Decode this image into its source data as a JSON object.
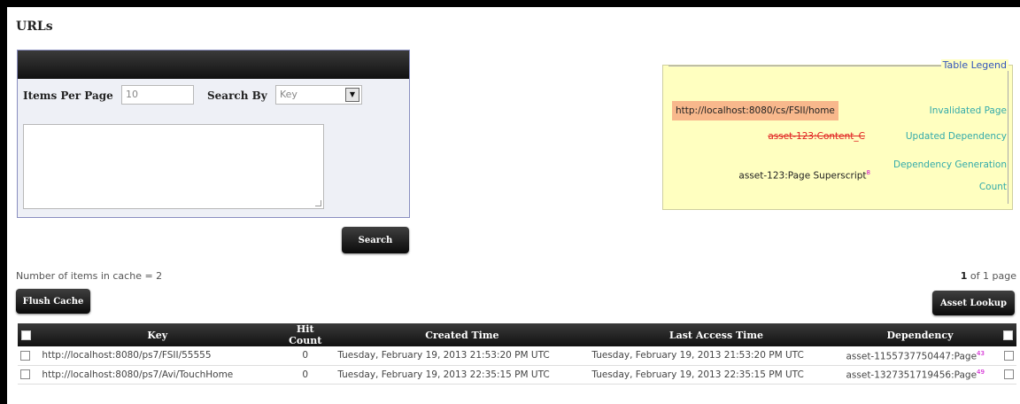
{
  "page_title": "URLs",
  "search": {
    "items_per_page_label": "Items Per Page",
    "items_per_page_value": "10",
    "search_by_label": "Search By",
    "search_by_value": "Key",
    "query_value": "",
    "search_button": "Search"
  },
  "legend": {
    "title": "Table Legend",
    "rows": [
      {
        "sample": "http://localhost:8080/cs/FSII/home",
        "meaning": "Invalidated Page"
      },
      {
        "sample": "asset-123:Content_C",
        "meaning": "Updated Dependency"
      },
      {
        "sample": "asset-123:Page Superscript",
        "sup": "8",
        "meaning_line1": "Dependency Generation",
        "meaning_line2": "Count"
      }
    ]
  },
  "cache_info": {
    "items_text": "Number of items in cache = 2",
    "page_current": "1",
    "page_suffix": "of 1 page"
  },
  "toolbar": {
    "flush_cache": "Flush Cache",
    "asset_lookup": "Asset Lookup"
  },
  "table": {
    "headers": {
      "key": "Key",
      "hit_count": "Hit Count",
      "created": "Created Time",
      "last_access": "Last Access Time",
      "dependency": "Dependency"
    },
    "rows": [
      {
        "key": "http://localhost:8080/ps7/FSII/55555",
        "hit_count": "0",
        "created": "Tuesday, February 19, 2013 21:53:20 PM UTC",
        "last_access": "Tuesday, February 19, 2013 21:53:20 PM UTC",
        "dependency": "asset-1155737750447:Page",
        "dep_sup": "43"
      },
      {
        "key": "http://localhost:8080/ps7/Avi/TouchHome",
        "hit_count": "0",
        "created": "Tuesday, February 19, 2013 22:35:15 PM UTC",
        "last_access": "Tuesday, February 19, 2013 22:35:15 PM UTC",
        "dependency": "asset-1327351719456:Page",
        "dep_sup": "49"
      }
    ]
  },
  "colors": {
    "legend_bg": "#ffffc0",
    "invalidated_bg": "#f8b88c",
    "updated_dependency": "#e02020",
    "legend_meaning": "#33aaaa",
    "superscript": "#cc00cc"
  }
}
